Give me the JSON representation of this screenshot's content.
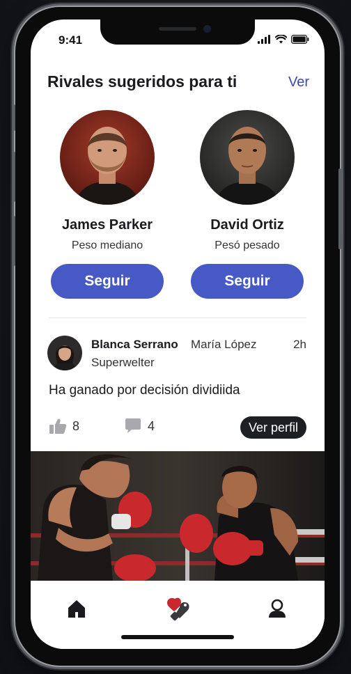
{
  "status_bar": {
    "time": "9:41"
  },
  "suggested": {
    "title": "Rivales sugeridos para ti",
    "see_all": "Ver",
    "rivals": [
      {
        "name": "James Parker",
        "weight_class": "Peso mediano",
        "button": "Seguir"
      },
      {
        "name": "David Ortiz",
        "weight_class": "Pesó pesado",
        "button": "Seguir"
      }
    ]
  },
  "post": {
    "author": "Blanca Serrano",
    "mention": "María López",
    "time": "2h",
    "weight_class": "Superwelter",
    "text": "Ha ganado por decisión dividiida",
    "likes": "8",
    "comments": "4",
    "profile_button": "Ver perfil"
  },
  "colors": {
    "accent": "#4659c4",
    "link": "#3c4aa8",
    "glove_red": "#c9282c",
    "dark_button": "#1e1f22"
  },
  "tabbar": {
    "items": [
      {
        "icon": "home-icon"
      },
      {
        "icon": "boxing-gloves-icon"
      },
      {
        "icon": "profile-icon"
      }
    ]
  }
}
